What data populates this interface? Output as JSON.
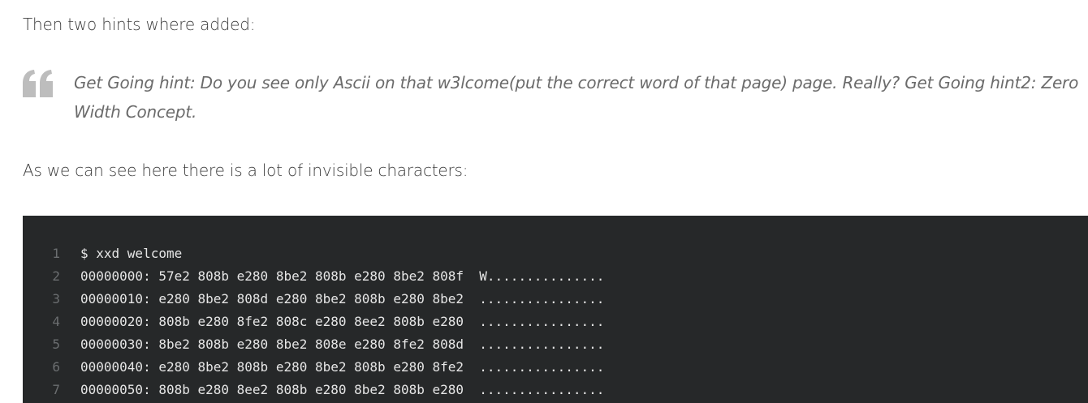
{
  "paragraphs": {
    "intro": "Then two hints where added:",
    "invisible": "As we can see here there is a lot of invisible characters:"
  },
  "quote": {
    "icon": "quote-icon",
    "text": "Get Going hint: Do you see only Ascii on that w3lcome(put the correct word of that page) page. Really? Get Going hint2: Zero Width Concept."
  },
  "code": {
    "lines": [
      {
        "num": "1",
        "text": "$ xxd welcome"
      },
      {
        "num": "2",
        "text": "00000000: 57e2 808b e280 8be2 808b e280 8be2 808f  W..............."
      },
      {
        "num": "3",
        "text": "00000010: e280 8be2 808d e280 8be2 808b e280 8be2  ................"
      },
      {
        "num": "4",
        "text": "00000020: 808b e280 8fe2 808c e280 8ee2 808b e280  ................"
      },
      {
        "num": "5",
        "text": "00000030: 8be2 808b e280 8be2 808e e280 8fe2 808d  ................"
      },
      {
        "num": "6",
        "text": "00000040: e280 8be2 808b e280 8be2 808b e280 8fe2  ................"
      },
      {
        "num": "7",
        "text": "00000050: 808b e280 8ee2 808b e280 8be2 808b e280  ................"
      }
    ]
  },
  "colors": {
    "code_background": "#262829",
    "quote_icon": "#bdbdbd"
  }
}
